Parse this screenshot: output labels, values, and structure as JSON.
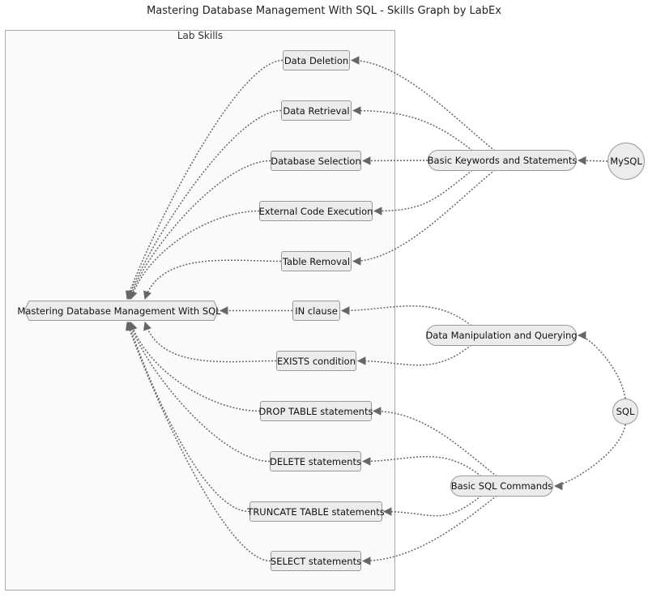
{
  "title": "Mastering Database Management With SQL - Skills Graph by LabEx",
  "cluster_label": "Lab Skills",
  "colors": {
    "node_fill": "#ececec",
    "node_stroke": "#999999",
    "edge": "#666666",
    "cluster_fill": "#fafafa",
    "cluster_stroke": "#aaaaaa"
  },
  "root": {
    "id": "root",
    "label": "Mastering Database Management With SQL",
    "shape": "hexagon"
  },
  "skills": [
    {
      "id": "data-deletion",
      "label": "Data Deletion"
    },
    {
      "id": "data-retrieval",
      "label": "Data Retrieval"
    },
    {
      "id": "database-selection",
      "label": "Database Selection"
    },
    {
      "id": "external-code-execution",
      "label": "External Code Execution"
    },
    {
      "id": "table-removal",
      "label": "Table Removal"
    },
    {
      "id": "in-clause",
      "label": "IN clause"
    },
    {
      "id": "exists-condition",
      "label": "EXISTS condition"
    },
    {
      "id": "drop-table-statements",
      "label": "DROP TABLE statements"
    },
    {
      "id": "delete-statements",
      "label": "DELETE statements"
    },
    {
      "id": "truncate-table-statements",
      "label": "TRUNCATE TABLE statements"
    },
    {
      "id": "select-statements",
      "label": "SELECT statements"
    }
  ],
  "categories": [
    {
      "id": "basic-keywords",
      "label": "Basic Keywords and Statements",
      "shape": "stadium"
    },
    {
      "id": "data-manipulation",
      "label": "Data Manipulation and Querying",
      "shape": "stadium"
    },
    {
      "id": "basic-sql-commands",
      "label": "Basic SQL Commands",
      "shape": "stadium"
    }
  ],
  "sources": [
    {
      "id": "mysql",
      "label": "MySQL",
      "shape": "circle"
    },
    {
      "id": "sql",
      "label": "SQL",
      "shape": "circle"
    }
  ],
  "edges": [
    {
      "from": "mysql",
      "to": "basic-keywords"
    },
    {
      "from": "sql",
      "to": "data-manipulation"
    },
    {
      "from": "sql",
      "to": "basic-sql-commands"
    },
    {
      "from": "basic-keywords",
      "to": "data-deletion"
    },
    {
      "from": "basic-keywords",
      "to": "data-retrieval"
    },
    {
      "from": "basic-keywords",
      "to": "database-selection"
    },
    {
      "from": "basic-keywords",
      "to": "external-code-execution"
    },
    {
      "from": "basic-keywords",
      "to": "table-removal"
    },
    {
      "from": "data-manipulation",
      "to": "in-clause"
    },
    {
      "from": "data-manipulation",
      "to": "exists-condition"
    },
    {
      "from": "basic-sql-commands",
      "to": "drop-table-statements"
    },
    {
      "from": "basic-sql-commands",
      "to": "delete-statements"
    },
    {
      "from": "basic-sql-commands",
      "to": "truncate-table-statements"
    },
    {
      "from": "basic-sql-commands",
      "to": "select-statements"
    },
    {
      "from": "data-deletion",
      "to": "root"
    },
    {
      "from": "data-retrieval",
      "to": "root"
    },
    {
      "from": "database-selection",
      "to": "root"
    },
    {
      "from": "external-code-execution",
      "to": "root"
    },
    {
      "from": "table-removal",
      "to": "root"
    },
    {
      "from": "in-clause",
      "to": "root"
    },
    {
      "from": "exists-condition",
      "to": "root"
    },
    {
      "from": "drop-table-statements",
      "to": "root"
    },
    {
      "from": "delete-statements",
      "to": "root"
    },
    {
      "from": "truncate-table-statements",
      "to": "root"
    },
    {
      "from": "select-statements",
      "to": "root"
    }
  ]
}
